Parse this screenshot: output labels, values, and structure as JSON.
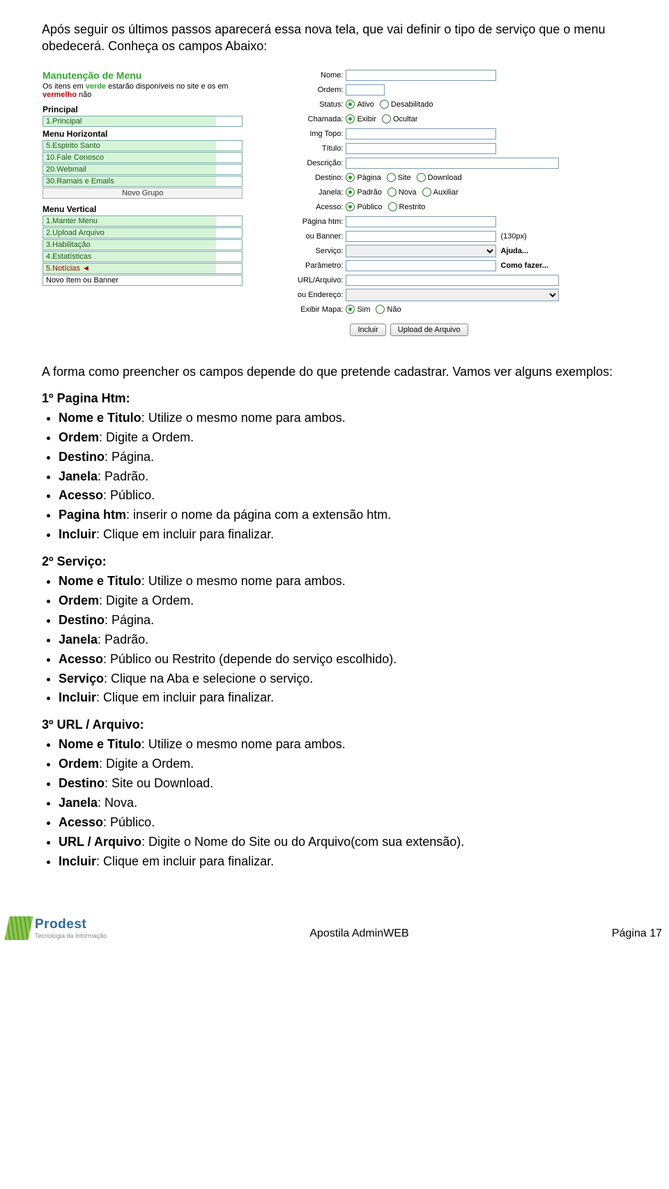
{
  "intro": "Após seguir os últimos passos aparecerá essa nova tela, que vai definir o tipo de serviço que o menu obedecerá.\nConheça os campos Abaixo:",
  "screenshot": {
    "title": "Manutenção de Menu",
    "legend_pre": "Os itens em ",
    "legend_verde": "verde",
    "legend_mid": " estarão disponíveis no site e os em ",
    "legend_verm": "vermelho",
    "legend_post": " não",
    "groups": {
      "principal_head": "Principal",
      "principal_items": [
        "1.Principal"
      ],
      "horiz_head": "Menu Horizontal",
      "horiz_items": [
        "5.Espirito Santo",
        "10.Fale Conosco",
        "20.Webmail",
        "30.Ramais e Emails"
      ],
      "novo_grupo": "Novo Grupo",
      "vert_head": "Menu Vertical",
      "vert_items": [
        "1.Manter Menu",
        "2.Upload Arquivo",
        "3.Habilitação",
        "4.Estatísticas"
      ],
      "vert_sel": "5.Notícias ◄",
      "novo_item": "Novo Item ou Banner"
    },
    "form": {
      "nome": "Nome:",
      "ordem": "Ordem:",
      "status": "Status:",
      "status_a": "Ativo",
      "status_b": "Desabilitado",
      "chamada": "Chamada:",
      "chamada_a": "Exibir",
      "chamada_b": "Ocultar",
      "imgtopo": "Img Topo:",
      "titulo": "Título:",
      "descricao": "Descrição:",
      "destino": "Destino:",
      "dest_a": "Página",
      "dest_b": "Site",
      "dest_c": "Download",
      "janela": "Janela:",
      "jan_a": "Padrão",
      "jan_b": "Nova",
      "jan_c": "Auxiliar",
      "acesso": "Acesso:",
      "ac_a": "Público",
      "ac_b": "Restrito",
      "paghtm": "Página htm:",
      "banner": "ou Banner:",
      "banner_sz": "(130px)",
      "servico": "Serviço:",
      "ajuda": "Ajuda...",
      "parametro": "Parâmetro:",
      "como": "Como fazer...",
      "urlarq": "URL/Arquivo:",
      "ouend": "ou Endereço:",
      "mapa": "Exibir Mapa:",
      "mapa_a": "Sim",
      "mapa_b": "Não",
      "btn_incluir": "Incluir",
      "btn_upload": "Upload de Arquivo"
    }
  },
  "after": "A forma como preencher os campos depende do que pretende cadastrar.\nVamos ver alguns exemplos:",
  "s1_title": "1º Pagina Htm:",
  "s1": [
    {
      "b": "Nome e Titulo",
      "t": ": Utilize o mesmo nome para ambos."
    },
    {
      "b": "Ordem",
      "t": ": Digite a Ordem."
    },
    {
      "b": "Destino",
      "t": ": Página."
    },
    {
      "b": "Janela",
      "t": ": Padrão."
    },
    {
      "b": "Acesso",
      "t": ": Público."
    },
    {
      "b": "Pagina htm",
      "t": ": inserir o nome da página com a extensão htm."
    },
    {
      "b": "Incluir",
      "t": ": Clique em incluir para finalizar."
    }
  ],
  "s2_title": "2º Serviço:",
  "s2": [
    {
      "b": "Nome e Titulo",
      "t": ": Utilize o mesmo nome para ambos."
    },
    {
      "b": "Ordem",
      "t": ": Digite a Ordem."
    },
    {
      "b": "Destino",
      "t": ": Página."
    },
    {
      "b": "Janela",
      "t": ": Padrão."
    },
    {
      "b": "Acesso",
      "t": ": Público ou Restrito (depende do serviço escolhido)."
    },
    {
      "b": "Serviço",
      "t": ": Clique na Aba e selecione o serviço."
    },
    {
      "b": "Incluir",
      "t": ": Clique em incluir para finalizar."
    }
  ],
  "s3_title": "3º URL / Arquivo:",
  "s3": [
    {
      "b": "Nome e Titulo",
      "t": ": Utilize o mesmo nome para ambos."
    },
    {
      "b": "Ordem",
      "t": ": Digite a Ordem."
    },
    {
      "b": "Destino",
      "t": ": Site ou Download."
    },
    {
      "b": "Janela",
      "t": ": Nova."
    },
    {
      "b": "Acesso",
      "t": ": Público."
    },
    {
      "b": "URL / Arquivo",
      "t": ": Digite o Nome do Site ou do Arquivo(com sua extensão)."
    },
    {
      "b": "Incluir",
      "t": ": Clique em incluir para finalizar."
    }
  ],
  "footer": {
    "brand": "Prodest",
    "tag": "Tecnologia da Informação",
    "center": "Apostila AdminWEB",
    "right": "Página 17"
  }
}
